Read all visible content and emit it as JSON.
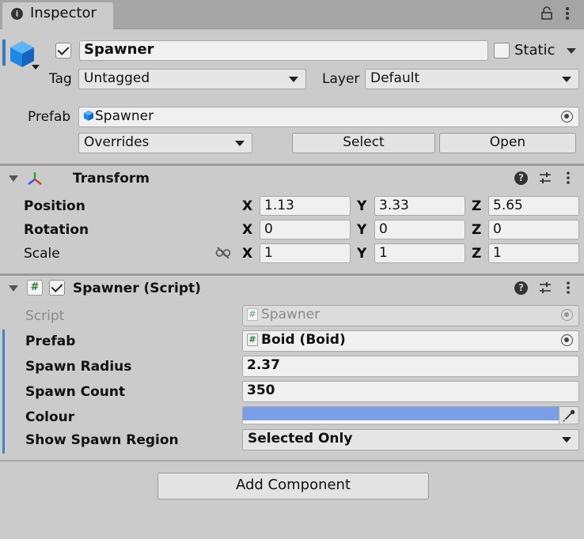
{
  "tab": {
    "title": "Inspector",
    "icon": "info-icon"
  },
  "object": {
    "name": "Spawner",
    "active": true,
    "static_label": "Static",
    "static_checked": false,
    "tag_label": "Tag",
    "tag_value": "Untagged",
    "layer_label": "Layer",
    "layer_value": "Default",
    "prefab_label": "Prefab",
    "prefab_value": "Spawner",
    "overrides_label": "Overrides",
    "select_label": "Select",
    "open_label": "Open"
  },
  "transform": {
    "title": "Transform",
    "rows": [
      {
        "label": "Position",
        "x": "1.13",
        "y": "3.33",
        "z": "5.65"
      },
      {
        "label": "Rotation",
        "x": "0",
        "y": "0",
        "z": "0"
      },
      {
        "label": "Scale",
        "x": "1",
        "y": "1",
        "z": "1"
      }
    ],
    "axis_labels": {
      "x": "X",
      "y": "Y",
      "z": "Z"
    }
  },
  "script_component": {
    "title": "Spawner (Script)",
    "enabled": true,
    "fields": {
      "script_label": "Script",
      "script_value": "Spawner",
      "prefab_label": "Prefab",
      "prefab_value": "Boid (Boid)",
      "spawn_radius_label": "Spawn Radius",
      "spawn_radius_value": "2.37",
      "spawn_count_label": "Spawn Count",
      "spawn_count_value": "350",
      "colour_label": "Colour",
      "colour_value": "#7b9fe6",
      "show_region_label": "Show Spawn Region",
      "show_region_value": "Selected Only"
    }
  },
  "add_component_label": "Add Component",
  "colors": {
    "selection": "#3a79bb",
    "override": "#3a88c9",
    "cube_blue": "#1e88e5"
  }
}
